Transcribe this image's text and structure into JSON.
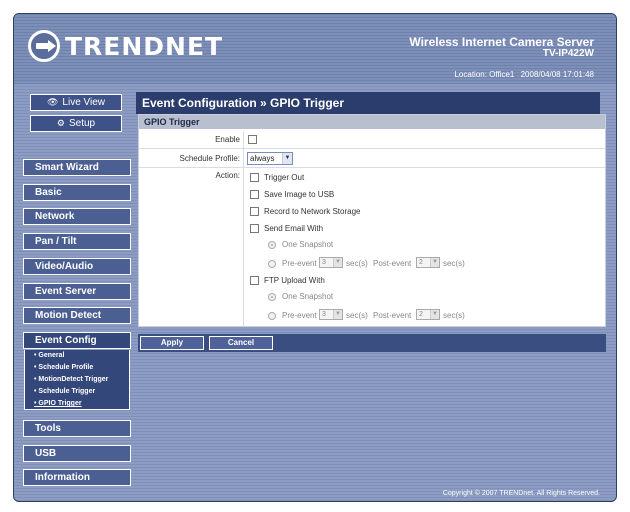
{
  "brand": {
    "logo_text": "TRENDNET"
  },
  "header": {
    "title": "Wireless Internet Camera Server",
    "model": "TV-IP422W",
    "location_label": "Location: Office1",
    "datetime": "2008/04/08 17:01:48"
  },
  "top_buttons": {
    "live_view": "Live View",
    "setup": "Setup"
  },
  "nav": [
    "Smart Wizard",
    "Basic",
    "Network",
    "Pan / Tilt",
    "Video/Audio",
    "Event Server",
    "Motion Detect",
    "Event Config",
    "Tools",
    "USB",
    "Information"
  ],
  "subnav": [
    "• General",
    "• Schedule Profile",
    "• MotionDetect Trigger",
    "• Schedule Trigger",
    "• GPIO Trigger"
  ],
  "page_title": "Event Configuration » GPIO Trigger",
  "panel": {
    "title": "GPIO Trigger",
    "enable_label": "Enable",
    "schedule_label": "Schedule Profile:",
    "schedule_value": "always",
    "action_label": "Action:",
    "trigger_out": "Trigger Out",
    "save_usb": "Save Image to USB",
    "record_storage": "Record to Network Storage",
    "send_email": "Send Email With",
    "ftp_upload": "FTP Upload With",
    "one_snapshot": "One Snapshot",
    "pre_event": "Pre-event",
    "pre_value": "3",
    "secs": "sec(s)",
    "post_event": "Post-event",
    "post_value": "2",
    "secs2": "sec(s)"
  },
  "buttons": {
    "apply": "Apply",
    "cancel": "Cancel"
  },
  "footer": "Copyright © 2007 TRENDnet. All Rights Reserved."
}
